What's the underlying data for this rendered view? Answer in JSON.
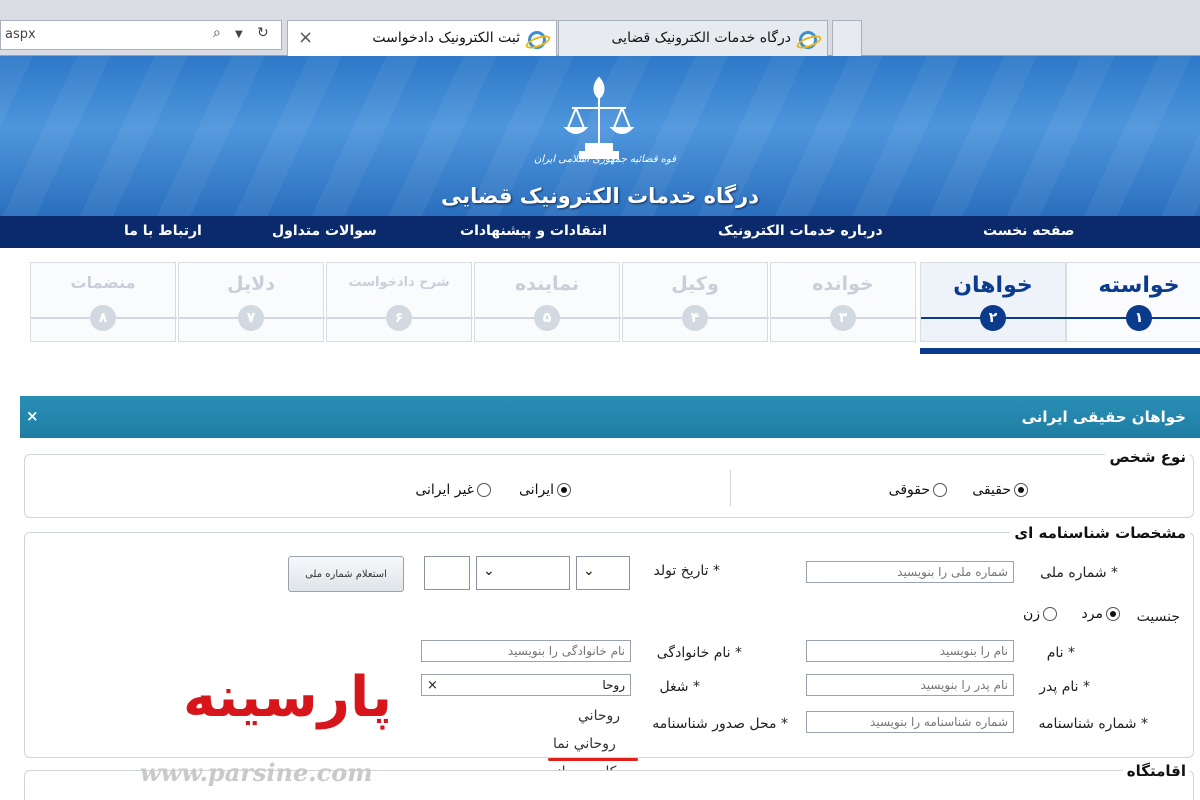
{
  "browser": {
    "address_text": "aspx",
    "search_icon": "search-icon",
    "dropdown_icon": "chevron-down-icon",
    "refresh_icon": "refresh-icon",
    "close_glyph": "×",
    "tabs": [
      {
        "title": "ثبت الکترونیک دادخواست",
        "active": true
      },
      {
        "title": "درگاه خدمات الکترونیک قضایی",
        "active": false
      }
    ]
  },
  "header": {
    "judiciary_text": "قوه قضائیه جمهوری اسلامی ایران",
    "portal_title": "درگاه خدمات الکترونیک قضایی"
  },
  "nav": {
    "items": [
      "صفحه نخست",
      "درباره خدمات الکترونیک",
      "انتقادات و پیشنهادات",
      "سوالات متداول",
      "ارتباط با ما"
    ]
  },
  "steps": [
    {
      "label": "خواسته",
      "num": "۱",
      "state": "done"
    },
    {
      "label": "خواهان",
      "num": "۲",
      "state": "current"
    },
    {
      "label": "خوانده",
      "num": "۳",
      "state": "todo"
    },
    {
      "label": "وکیل",
      "num": "۴",
      "state": "todo"
    },
    {
      "label": "نماینده",
      "num": "۵",
      "state": "todo"
    },
    {
      "label": "شرح دادخواست",
      "num": "۶",
      "state": "todo"
    },
    {
      "label": "دلایل",
      "num": "۷",
      "state": "todo"
    },
    {
      "label": "منضمات",
      "num": "۸",
      "state": "todo"
    }
  ],
  "panel": {
    "title": "خواهان حقیقی ایرانی",
    "close": "×"
  },
  "person_type": {
    "legend": "نوع شخص",
    "real": "حقیقی",
    "legal": "حقوقی",
    "iranian": "ایرانی",
    "non_iranian": "غیر ایرانی"
  },
  "identity": {
    "legend": "مشخصات شناسنامه ای",
    "national_code_label": "* شماره ملی",
    "national_code_placeholder": "شماره ملی را بنویسید",
    "birth_date_label": "* تاریخ تولد",
    "inquiry_button": "استعلام شماره ملی",
    "gender_label": "جنسیت",
    "male": "مرد",
    "female": "زن",
    "first_name_label": "* نام",
    "first_name_placeholder": "نام را بنویسید",
    "last_name_label": "* نام خانوادگی",
    "last_name_placeholder": "نام خانوادگی را بنویسید",
    "father_name_label": "* نام پدر",
    "father_name_placeholder": "نام پدر را بنویسید",
    "job_label": "* شغل",
    "job_value": "روحا",
    "job_clear": "×",
    "birth_cert_label": "* شماره شناسنامه",
    "birth_cert_placeholder": "شماره شناسنامه را بنویسید",
    "issue_place_label": "* محل صدور شناسنامه",
    "job_suggestions": [
      "روحاني",
      "روحاني نما",
      "کادر روحاني"
    ]
  },
  "residence": {
    "legend": "اقامتگاه"
  },
  "watermark": {
    "logo": "پارسینه",
    "url": "www.parsine.com"
  },
  "colors": {
    "nav_bg": "#0b2a6b",
    "step_active": "#0b3b8c",
    "panel_head": "#2a8fb5",
    "watermark_red": "#d6161b"
  }
}
